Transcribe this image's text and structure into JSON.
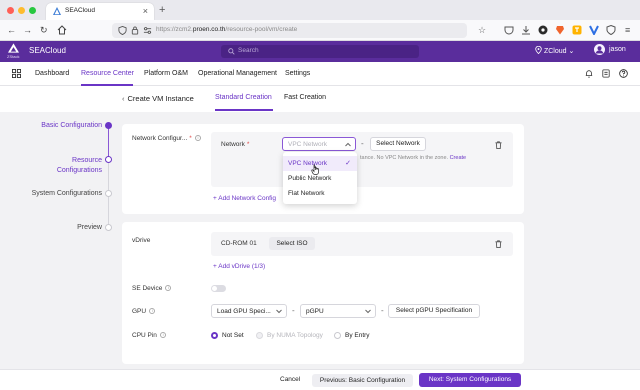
{
  "browser": {
    "tab_title": "SEACloud",
    "url_prefix": "https://zcm2.",
    "url_domain": "proen.co.th",
    "url_path": "/resource-pool/vm/create"
  },
  "app": {
    "name": "SEACloud",
    "logo_sub": "ZStack",
    "search_placeholder": "Search",
    "zone": "ZCloud",
    "user": "jason",
    "brand_color": "#5a2d9c",
    "accent_color": "#6a35c6"
  },
  "nav": {
    "items": [
      "Dashboard",
      "Resource Center",
      "Platform O&M",
      "Operational Management",
      "Settings"
    ]
  },
  "page": {
    "title": "Create VM Instance",
    "back_icon": "chevron-left-icon",
    "modes": [
      "Standard Creation",
      "Fast Creation"
    ]
  },
  "steps": [
    "Basic Configuration",
    "Resource Configurations",
    "System Configurations",
    "Preview"
  ],
  "network": {
    "section_label": "Network Configur...",
    "field_label": "Network",
    "select_placeholder": "VPC Network",
    "select_button": "Select Network",
    "hint_text": "tance. No VPC Network in the zone.",
    "hint_link": "Create",
    "add_link": "+ Add Network Config",
    "options": [
      "VPC Network",
      "Public Network",
      "Flat Network"
    ]
  },
  "vdrive": {
    "label": "vDrive",
    "drive_name": "CD-ROM 01",
    "select_button": "Select ISO",
    "add_link": "+ Add vDrive (1/3)"
  },
  "se_device": {
    "label": "SE Device",
    "enabled": false
  },
  "gpu": {
    "label": "GPU",
    "spec_select": "Load GPU Speci...",
    "type_select": "pGPU",
    "spec_button": "Select pGPU Specification"
  },
  "cpu_pin": {
    "label": "CPU Pin",
    "options": [
      "Not Set",
      "By NUMA Topology",
      "By Entry"
    ],
    "selected": "Not Set"
  },
  "footer": {
    "cancel": "Cancel",
    "previous": "Previous: Basic Configuration",
    "next": "Next: System Configurations"
  }
}
